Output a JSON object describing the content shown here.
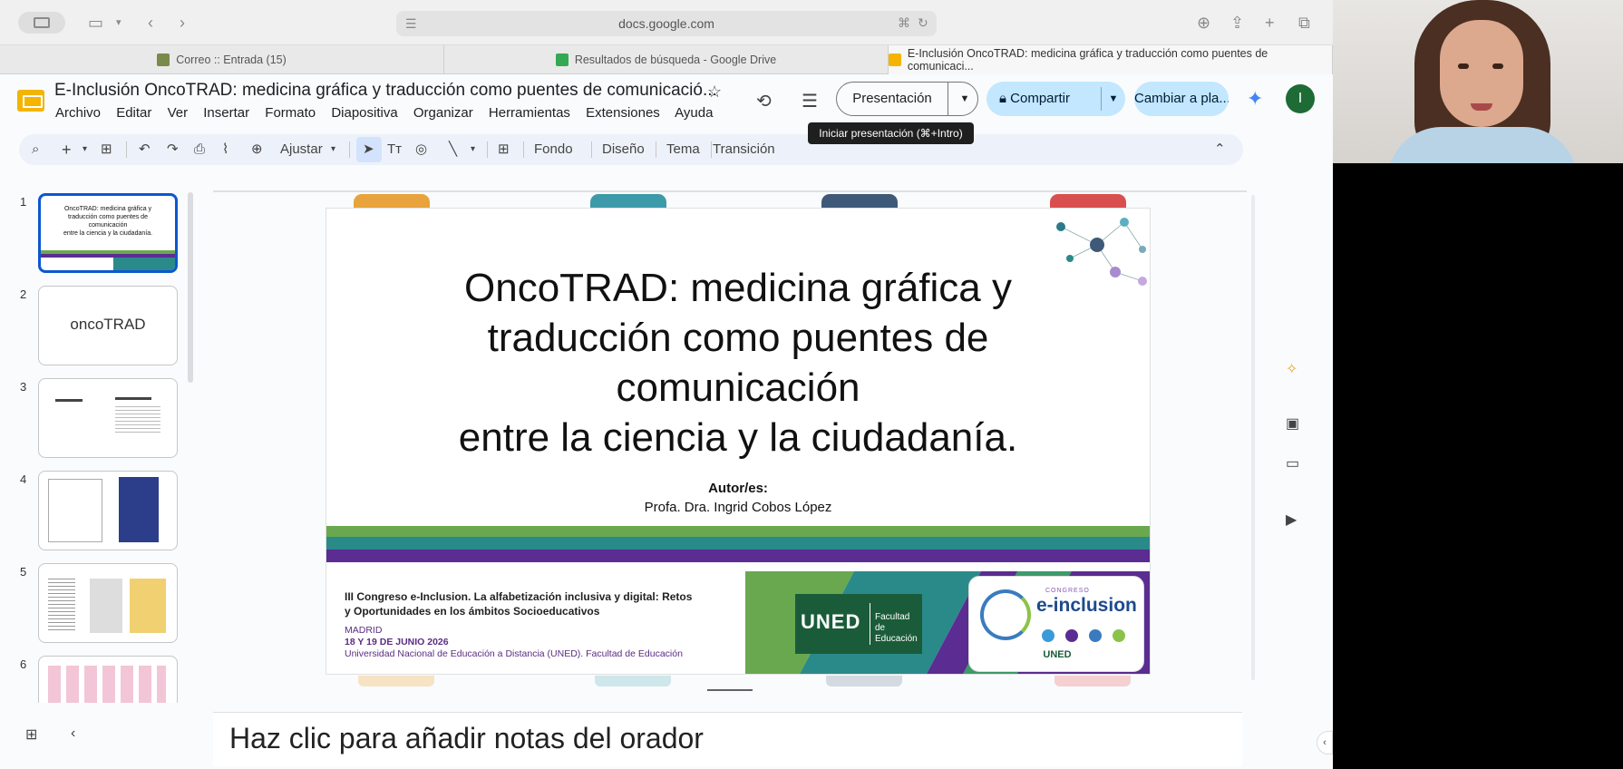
{
  "browser": {
    "url": "docs.google.com",
    "tabs": [
      {
        "label": "Correo :: Entrada (15)",
        "icon_color": "#7a8a4a"
      },
      {
        "label": "Resultados de búsqueda - Google Drive",
        "icon_color": "#34a853"
      },
      {
        "label": "E-Inclusión OncoTRAD: medicina gráfica y traducción como puentes de comunicaci...",
        "icon_color": "#f4b400"
      }
    ]
  },
  "doc": {
    "title": "E-Inclusión OncoTRAD: medicina gráfica y traducción como puentes de comunicació...",
    "menu": [
      "Archivo",
      "Editar",
      "Ver",
      "Insertar",
      "Formato",
      "Diapositiva",
      "Organizar",
      "Herramientas",
      "Extensiones",
      "Ayuda"
    ],
    "present_label": "Presentación",
    "share_label": "Compartir",
    "switch_label": "Cambiar a pla...",
    "avatar_letter": "I",
    "tooltip": "Iniciar presentación (⌘+Intro)"
  },
  "toolbar": {
    "zoom_label": "Ajustar",
    "fondo": "Fondo",
    "diseno": "Diseño",
    "tema": "Tema",
    "transicion": "Transición"
  },
  "thumbnails": {
    "numbers": [
      "1",
      "2",
      "3",
      "4",
      "5",
      "6"
    ],
    "slide2_text": "oncoTRAD",
    "slide1_lines": [
      "OncoTRAD: medicina gráfica y",
      "traducción como puentes de",
      "comunicación",
      "entre la ciencia y la ciudadanía."
    ]
  },
  "slide": {
    "title_lines": [
      "OncoTRAD: medicina gráfica y",
      "traducción como puentes de",
      "comunicación",
      "entre la ciencia y la ciudadanía."
    ],
    "author_heading": "Autor/es:",
    "author": "Profa. Dra. Ingrid Cobos López",
    "footer_title_1": "III Congreso e-Inclusion. La alfabetización inclusiva y digital: Retos",
    "footer_title_2": "y Oportunidades en los ámbitos Socioeducativos",
    "footer_city": "MADRID",
    "footer_date": "18 Y 19 DE JUNIO 2026",
    "footer_uni": "Universidad Nacional de Educación a Distancia (UNED). Facultad de Educación",
    "uned_word": "UNED",
    "uned_faculty": "Facultad de Educación",
    "congress_small": "CONGRESO",
    "congress_big": "e-inclusion",
    "congress_uned": "UNED"
  },
  "notes": {
    "placeholder": "Haz clic para añadir notas del orador"
  },
  "colors": {
    "accent_orange": "#e8a33d",
    "accent_teal": "#3d9aa8",
    "accent_navy": "#3e5a78",
    "accent_red": "#d94f4f",
    "band_green": "#6aa84f",
    "band_teal": "#2a8a8a",
    "band_purple": "#5b2c91"
  }
}
